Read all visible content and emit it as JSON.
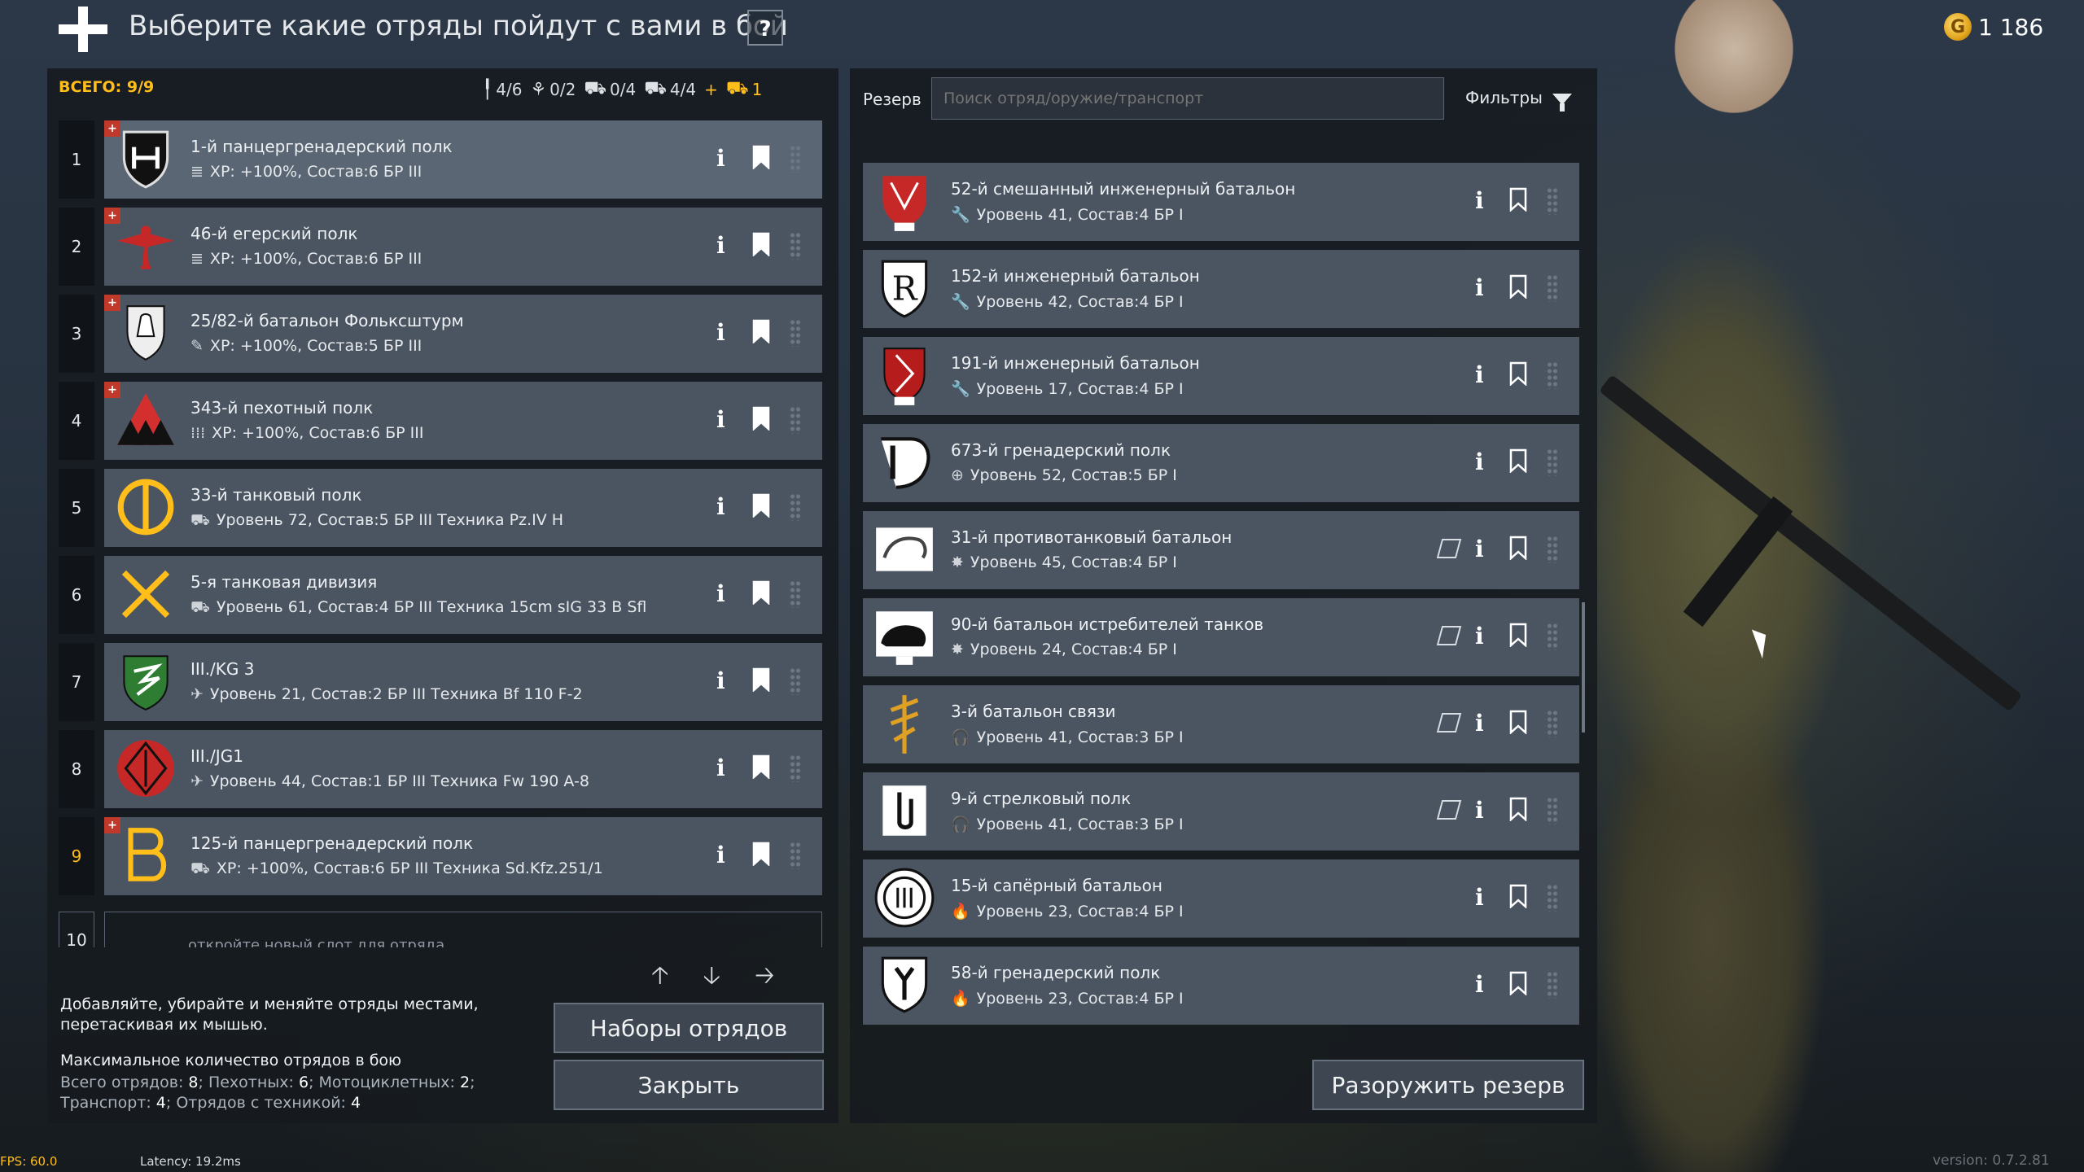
{
  "header": {
    "title": "Выберите какие отряды пойдут с вами в бой",
    "help": "?",
    "currency_icon": "G",
    "currency": "1 186"
  },
  "counts": {
    "total": "ВСЕГО: 9/9",
    "infantry": "4/6",
    "paratroop": "0/2",
    "motorcycle": "0/4",
    "vehicle": "4/4",
    "plus": "+",
    "transport": "1"
  },
  "squads": [
    {
      "n": "1",
      "name": "1-й панцергренадерский  полк",
      "stats": "XP: +100%, Состав:6  БР III",
      "badge": "+",
      "icon": "≣",
      "sel": true
    },
    {
      "n": "2",
      "name": "46-й егерский полк",
      "stats": "XP: +100%, Состав:6  БР III",
      "badge": "+",
      "icon": "≣"
    },
    {
      "n": "3",
      "name": "25/82-й батальон Фольксштурм",
      "stats": "XP: +100%, Состав:5  БР III",
      "badge": "+",
      "icon": "✎"
    },
    {
      "n": "4",
      "name": "343-й пехотный полк",
      "stats": "XP: +100%, Состав:6  БР III",
      "badge": "+",
      "icon": "⁞⁞⁞"
    },
    {
      "n": "5",
      "name": "33-й танковый полк",
      "stats": "Уровень 72, Состав:5  БР III  Техника Pz.IV H",
      "icon": "⛟"
    },
    {
      "n": "6",
      "name": "5-я танковая дивизия",
      "stats": "Уровень 61, Состав:4  БР III  Техника 15cm sIG 33 B Sfl",
      "icon": "⛟"
    },
    {
      "n": "7",
      "name": "III./KG 3",
      "stats": "Уровень 21, Состав:2  БР III  Техника Bf 110 F-2",
      "icon": "✈"
    },
    {
      "n": "8",
      "name": "III./JG1",
      "stats": "Уровень 44, Состав:1  БР III  Техника Fw 190 A-8",
      "icon": "✈"
    },
    {
      "n": "9",
      "name": "125-й панцергренадерский полк",
      "stats": "XP: +100%, Состав:6  БР III  Техника Sd.Kfz.251/1",
      "badge": "+",
      "icon": "⛟"
    }
  ],
  "new_slot": {
    "n": "10",
    "hint": "откройте новый слот для отряда"
  },
  "arrows": {
    "up": "🡡",
    "down": "🡣",
    "right": "🡢"
  },
  "help_text": {
    "line1": "Добавляйте, убирайте и меняйте отряды местами,",
    "line2": "перетаскивая их мышью."
  },
  "max": {
    "title": "Максимальное количество отрядов в бою",
    "l1a": "Всего отрядов: ",
    "l1b": "8",
    "l1c": "; Пехотных: ",
    "l1d": "6",
    "l1e": "; Мотоциклетных: ",
    "l1f": "2",
    "l1g": ";",
    "l2a": "Транспорт: ",
    "l2b": "4",
    "l2c": "; Отрядов с техникой: ",
    "l2d": "4"
  },
  "buttons": {
    "presets": "Наборы отрядов",
    "close": "Закрыть",
    "disarm": "Разоружить резерв"
  },
  "reserve": {
    "label": "Резерв",
    "search_placeholder": "Поиск отряд/оружие/транспорт",
    "filters": "Фильтры"
  },
  "reserve_squads": [
    {
      "name": "52-й смешанный инженерный батальон",
      "stats": "Уровень 41, Состав:4  БР I",
      "icon": "🔧"
    },
    {
      "name": "152-й инженерный батальон",
      "stats": "Уровень 42, Состав:4  БР I",
      "icon": "🔧"
    },
    {
      "name": "191-й инженерный батальон",
      "stats": "Уровень 17, Состав:4  БР I",
      "icon": "🔧"
    },
    {
      "name": "673-й гренадерский полк",
      "stats": "Уровень 52, Состав:5  БР I",
      "icon": "⊕"
    },
    {
      "name": "31-й противотанковый батальон",
      "stats": "Уровень 45, Состав:4  БР I",
      "icon": "✸",
      "book": true
    },
    {
      "name": "90-й батальон истребителей танков",
      "stats": "Уровень 24, Состав:4  БР I",
      "icon": "✸",
      "book": true
    },
    {
      "name": "3-й батальон связи",
      "stats": "Уровень 41, Состав:3  БР I",
      "icon": "🎧",
      "book": true
    },
    {
      "name": "9-й стрелковый полк",
      "stats": "Уровень 41, Состав:3  БР I",
      "icon": "🎧",
      "book": true
    },
    {
      "name": "15-й сапёрный батальон",
      "stats": "Уровень 23, Состав:4  БР I",
      "icon": "🔥"
    },
    {
      "name": "58-й гренадерский полк",
      "stats": "Уровень 23, Состав:4  БР I",
      "icon": "🔥"
    }
  ],
  "footer": {
    "fps": "FPS: 60.0",
    "latency": "Latency:  19.2ms",
    "version": "version: 0.7.2.81"
  },
  "colors": {
    "accent": "#ffbe1a",
    "card": "#4b5562",
    "card_selected": "#5a6673"
  }
}
